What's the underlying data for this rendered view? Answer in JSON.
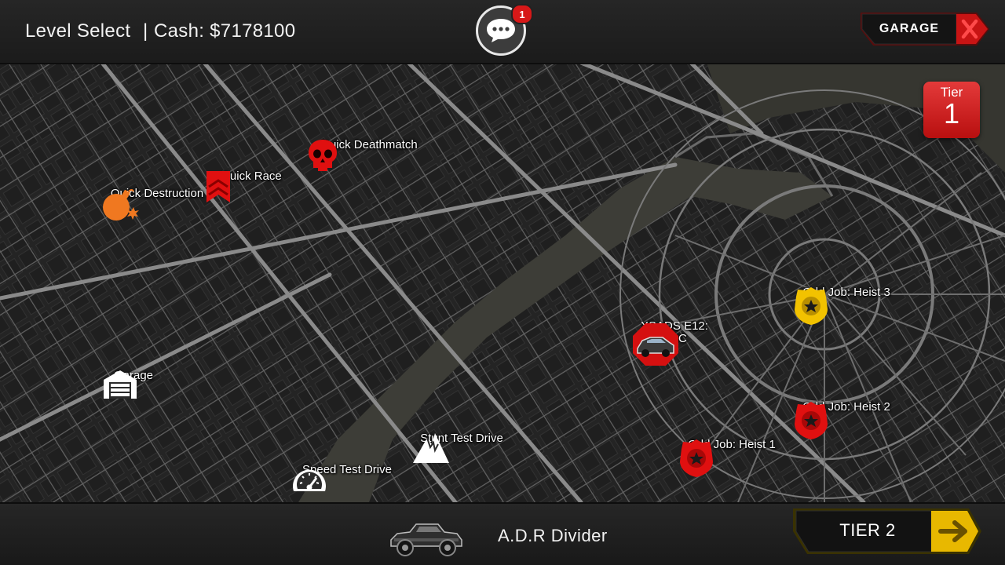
{
  "header": {
    "title": "Level Select",
    "separator": "|",
    "cash_label": "Cash: $7178100",
    "chat_badge_count": "1",
    "garage_button_label": "GARAGE",
    "close_icon": "x-icon"
  },
  "tier_badge": {
    "label": "Tier",
    "number": "1"
  },
  "map": {
    "markers": [
      {
        "label": "Quick Deathmatch",
        "icon": "skull-icon",
        "color": "#e01010"
      },
      {
        "label": "Quick Race",
        "icon": "race-flag-icon",
        "color": "#e01010"
      },
      {
        "label": "Quick Destruction",
        "icon": "bomb-icon",
        "color": "#f07820"
      },
      {
        "label": "Garage",
        "icon": "garage-icon",
        "color": "#ffffff"
      },
      {
        "label": "Speed Test Drive",
        "icon": "speedometer-icon",
        "color": "#ffffff"
      },
      {
        "label": "Stunt Test Drive",
        "icon": "mountain-icon",
        "color": "#ffffff"
      },
      {
        "label": "XSADS E12: XRC",
        "icon": "car-hexagon-icon",
        "color": "#e01010"
      },
      {
        "label": "Odd Job: Heist 3",
        "icon": "police-badge-icon",
        "color": "#f2c200"
      },
      {
        "label": "Odd Job: Heist 2",
        "icon": "police-badge-icon",
        "color": "#e01010"
      },
      {
        "label": "Odd Job: Heist 1",
        "icon": "police-badge-icon",
        "color": "#e01010"
      }
    ]
  },
  "footer": {
    "car_name": "A.D.R Divider",
    "next_tier_label": "TIER 2",
    "arrow_icon": "arrow-right-icon"
  },
  "colors": {
    "accent_red": "#d71818",
    "accent_yellow": "#f2c200",
    "map_bg": "#2b2b2b",
    "road": "#7a7a7a"
  }
}
